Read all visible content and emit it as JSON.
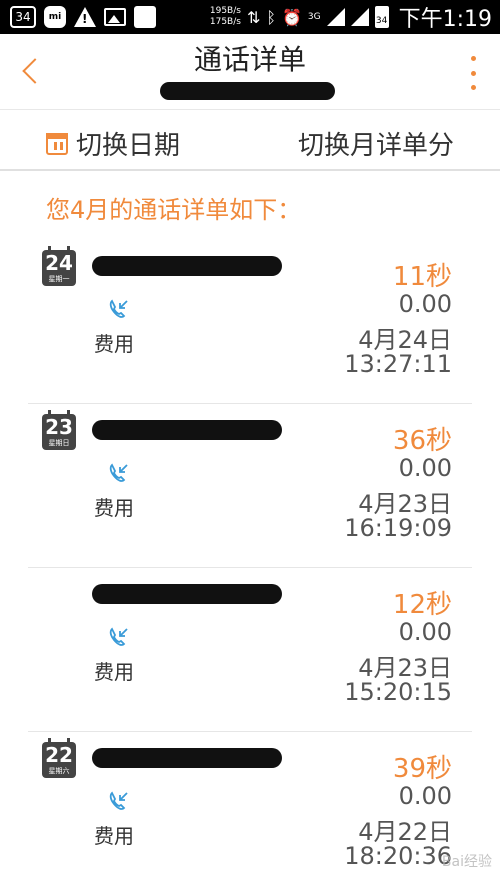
{
  "status_bar": {
    "notification_count": "34",
    "mi_label": "mi",
    "upload_rate": "195B/s",
    "download_rate": "175B/s",
    "network": "3G",
    "battery": "34",
    "time": "下午1:19",
    "icons": [
      "notification-box-icon",
      "mi-icon",
      "warning-icon",
      "image-icon",
      "app-icon",
      "data-transfer-icon",
      "bluetooth-icon",
      "alarm-icon",
      "signal-icon",
      "battery-icon"
    ]
  },
  "header": {
    "title": "通话详单",
    "accent_color": "#f08a3c"
  },
  "toolbar": {
    "switch_date_label": "切换日期",
    "switch_month_label": "切换月详单分"
  },
  "section_title": "您4月的通话详单如下：",
  "calls": [
    {
      "day": "24",
      "weekday": "星期一",
      "duration": "11秒",
      "cost": "0.00",
      "date": "4月24日",
      "time": "13:27:11",
      "fee_label": "费用"
    },
    {
      "day": "23",
      "weekday": "星期日",
      "duration": "36秒",
      "cost": "0.00",
      "date": "4月23日",
      "time": "16:19:09",
      "fee_label": "费用"
    },
    {
      "day": "",
      "weekday": "",
      "duration": "12秒",
      "cost": "0.00",
      "date": "4月23日",
      "time": "15:20:15",
      "fee_label": "费用"
    },
    {
      "day": "22",
      "weekday": "星期六",
      "duration": "39秒",
      "cost": "0.00",
      "date": "4月22日",
      "time": "18:20:36",
      "fee_label": "费用"
    }
  ],
  "watermark": "Bai经验"
}
